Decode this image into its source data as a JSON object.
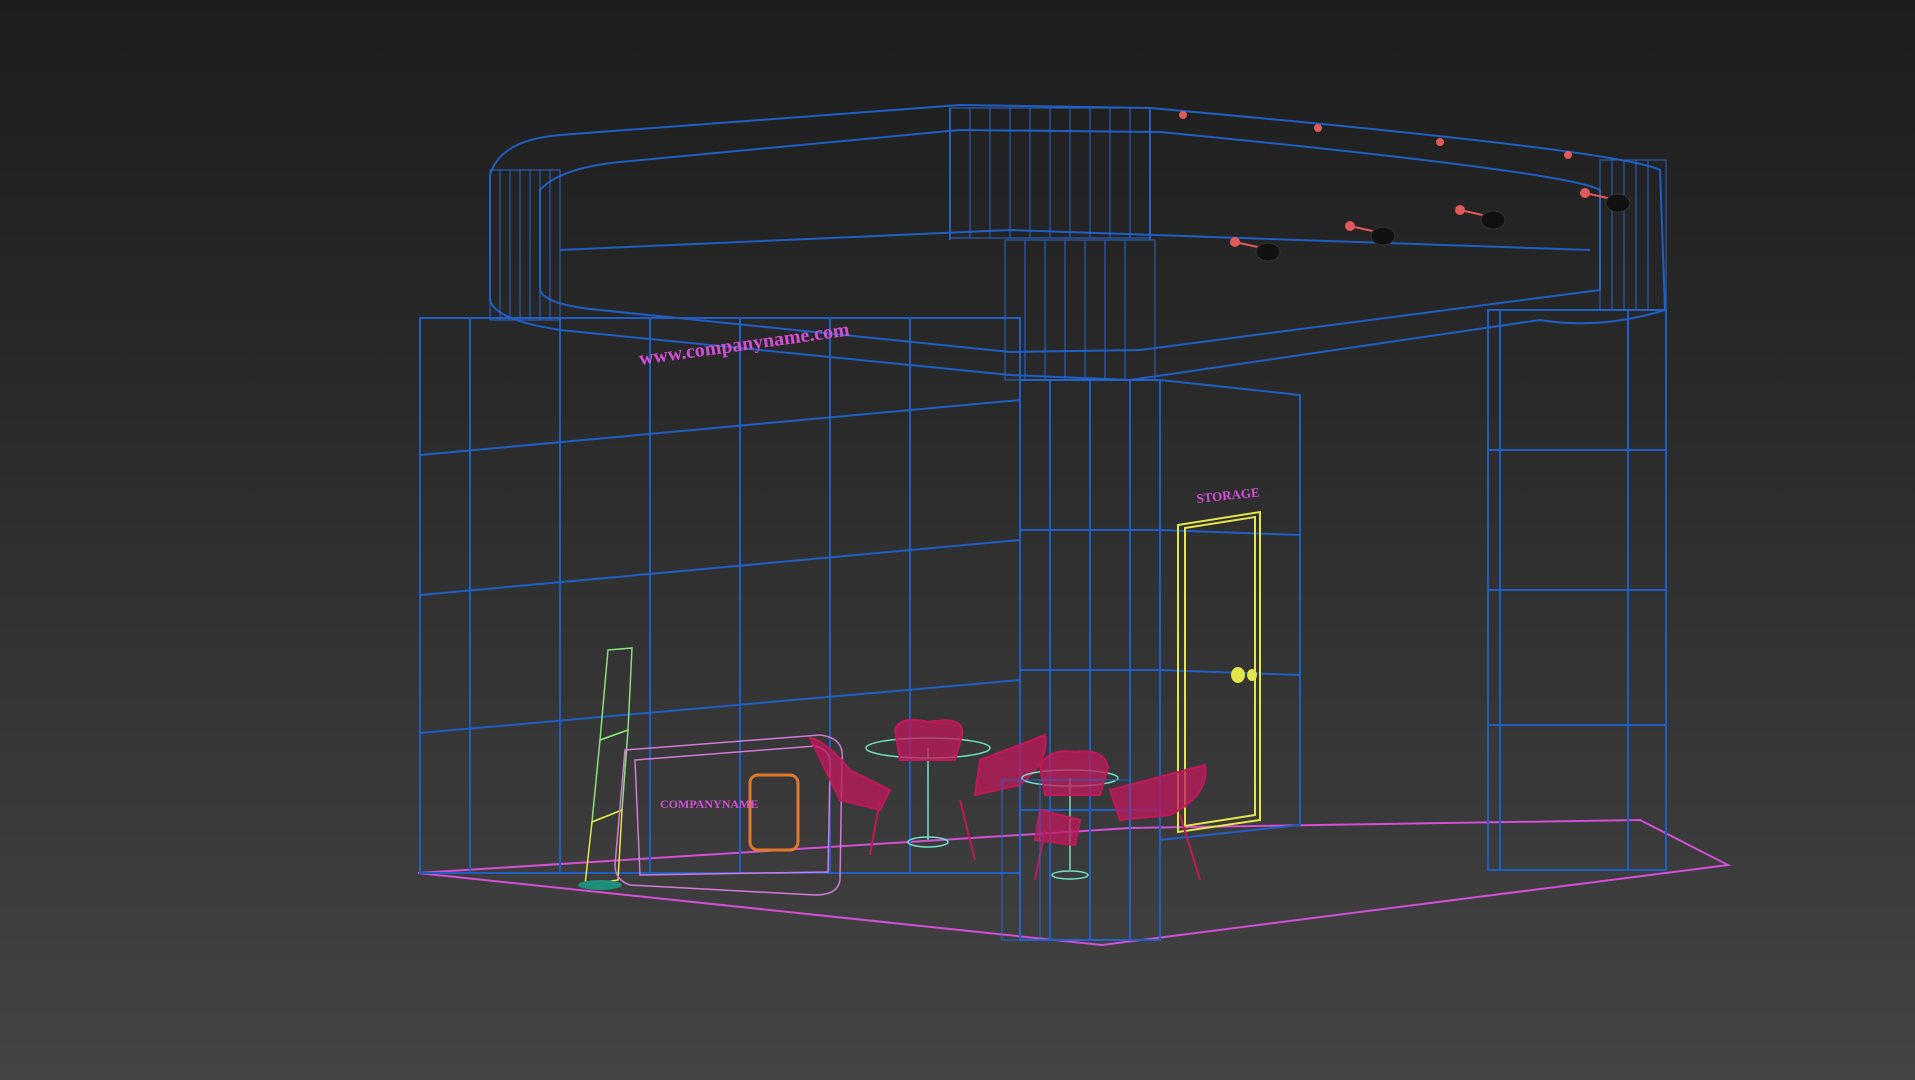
{
  "viewport": {
    "background_top": "#1d1d1d",
    "background_bottom": "#444444",
    "render_mode": "wireframe"
  },
  "scene": {
    "header_url_text": "www.companyname.com",
    "counter_text": "COMPANYNAME",
    "door_sign_text": "STORAGE",
    "colors": {
      "frame": "#1f5fc4",
      "floor_outline": "#d24fd6",
      "chairs": "#c2185b",
      "door": "#e3e64a",
      "tables": "#6fe3c8",
      "spotlights": "#e05a5a"
    }
  }
}
